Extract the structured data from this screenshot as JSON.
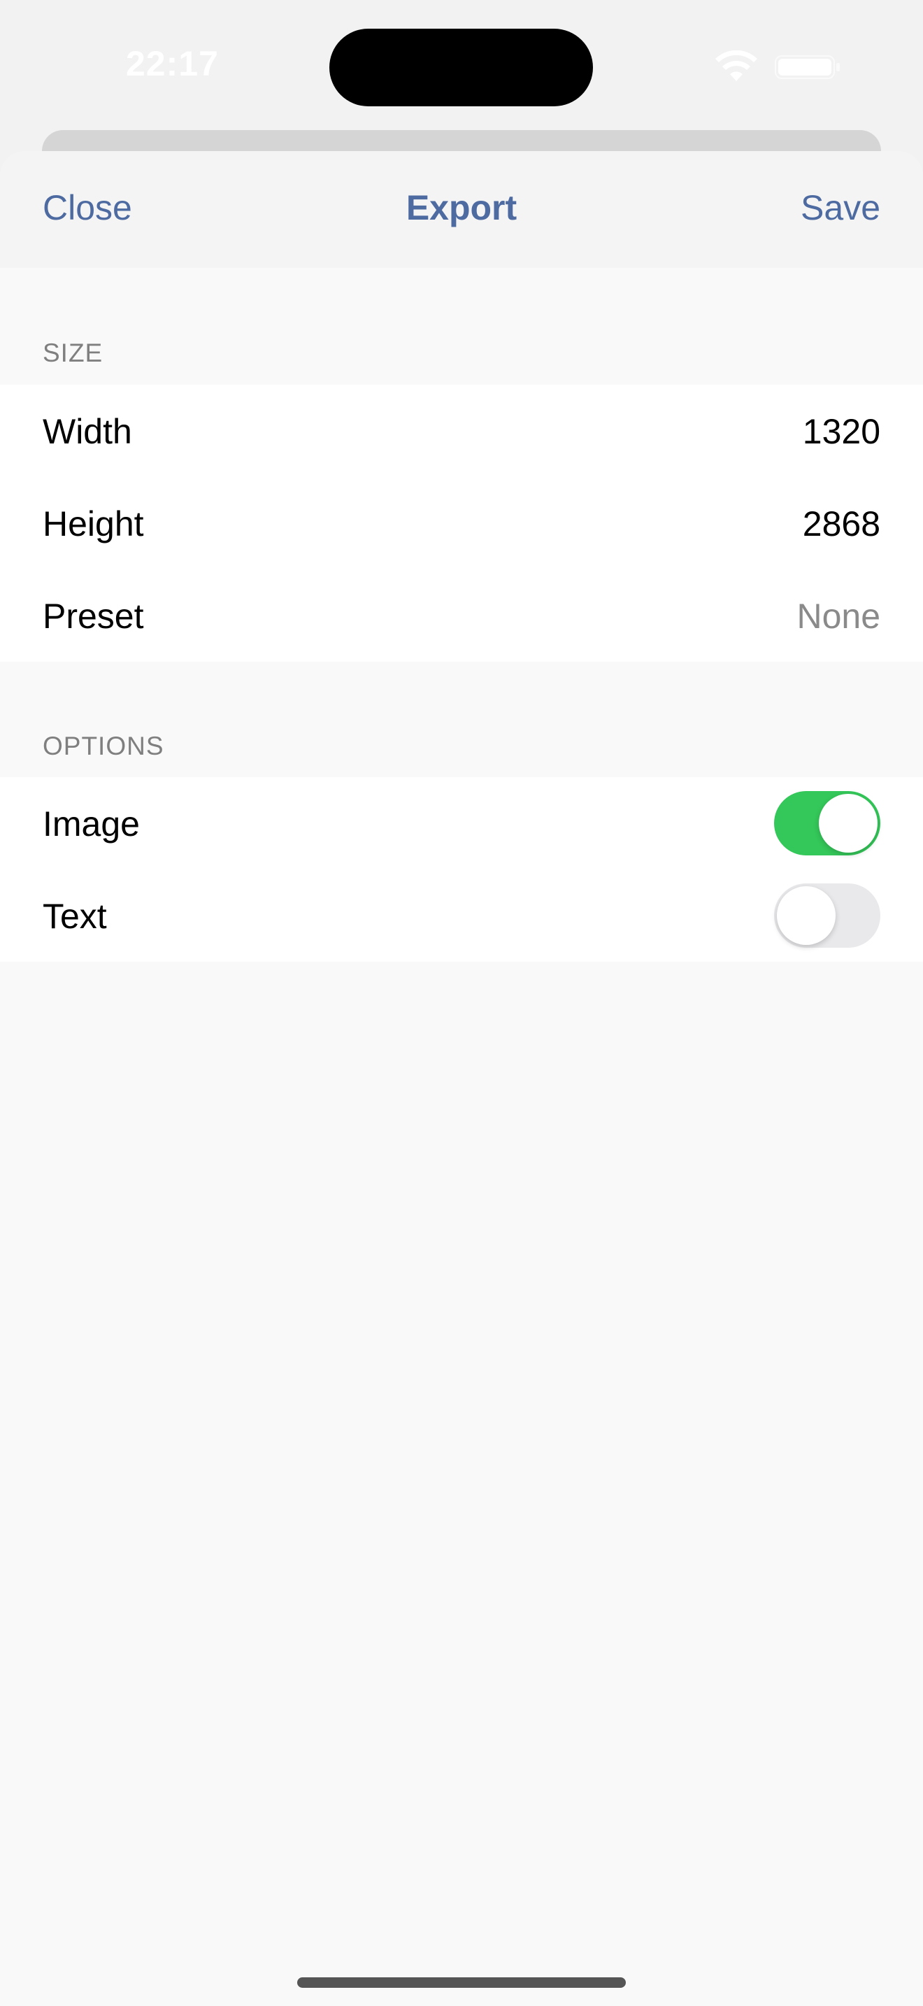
{
  "status_bar": {
    "time": "22:17",
    "wifi_icon": "wifi-icon",
    "battery_icon": "battery-icon"
  },
  "nav": {
    "close_label": "Close",
    "title": "Export",
    "save_label": "Save",
    "accent_color": "#4d6aa1"
  },
  "sections": {
    "size": {
      "header": "SIZE",
      "rows": [
        {
          "label": "Width",
          "value": "1320"
        },
        {
          "label": "Height",
          "value": "2868"
        },
        {
          "label": "Preset",
          "value": "None"
        }
      ]
    },
    "options": {
      "header": "OPTIONS",
      "rows": [
        {
          "label": "Image",
          "enabled": true
        },
        {
          "label": "Text",
          "enabled": false
        }
      ]
    }
  },
  "colors": {
    "toggle_on": "#34c759",
    "toggle_off": "#e9e9eb"
  }
}
